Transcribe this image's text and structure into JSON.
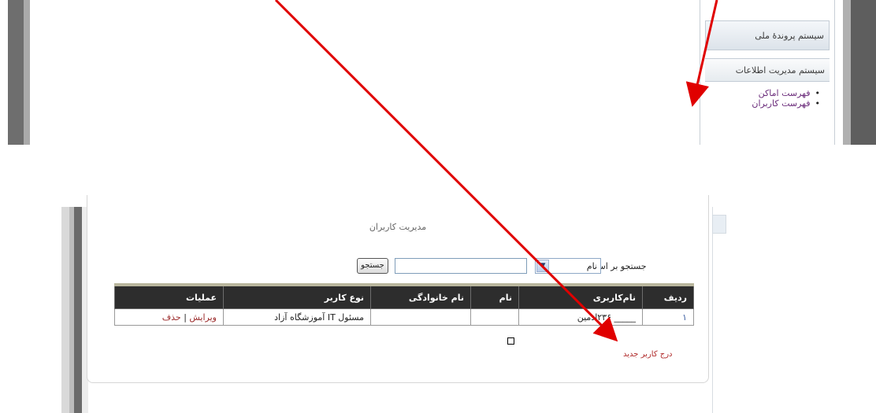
{
  "top_panel": {
    "system_title": "سیستم پروندهٔ ملی",
    "section_title": "سیستم مدیریت اطلاعات",
    "links": [
      "فهرست اماکن",
      "فهرست کاربران"
    ]
  },
  "users_page": {
    "title": "مدیریت کاربران",
    "search": {
      "label": "جستجو بر اساس:",
      "select_value": "نام",
      "input_value": "",
      "button_label": "جستجو"
    },
    "table": {
      "headers": [
        "ردیف",
        "نام‌کاربری",
        "نام",
        "نام خانوادگی",
        "نوع کاربر",
        "عملیات"
      ],
      "rows": [
        {
          "index": "۱",
          "username": "_____ ۲۳۶ادمین",
          "first_name": "",
          "last_name": "",
          "user_type": "مسئول IT آموزشگاه آزاد",
          "edit": "ویرایش",
          "separator": "|",
          "delete": "حذف"
        }
      ]
    },
    "insert_link": "درج کاربر جدید"
  },
  "colors": {
    "annotation_arrow": "#e00000",
    "table_header_bg": "#2d2d2d",
    "link_purple": "#6a2b7a",
    "action_red": "#9b2a2a"
  }
}
